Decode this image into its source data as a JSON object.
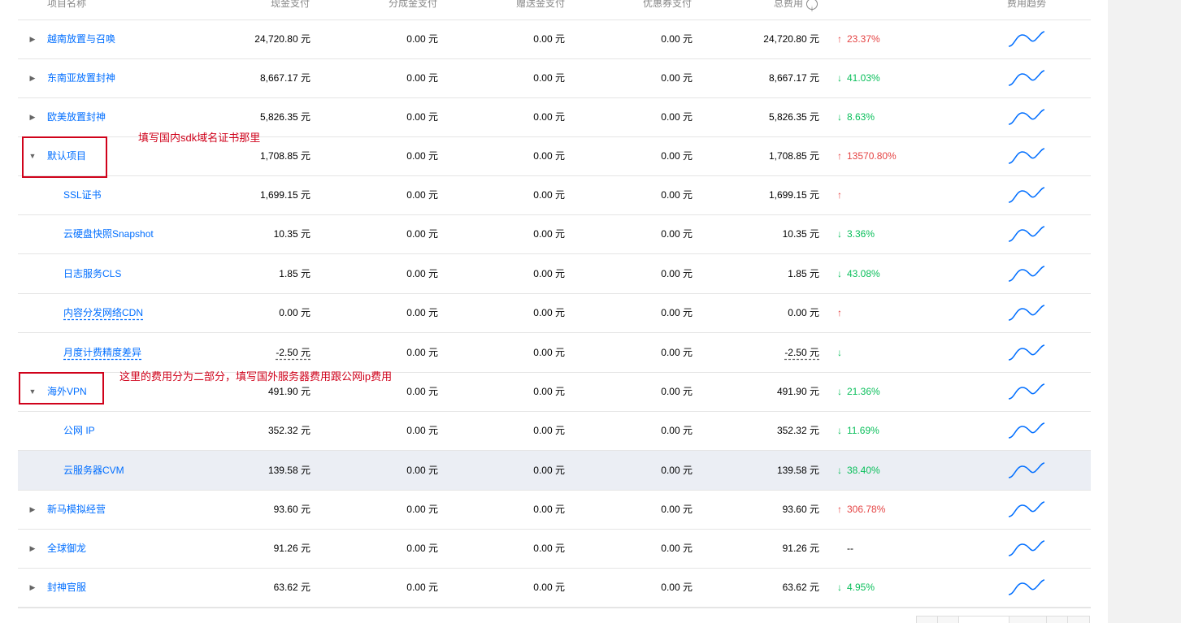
{
  "header": {
    "project_name": "项目名称",
    "cash_pay": "现金支付",
    "share_pay": "分成金支付",
    "gift_pay": "赠送金支付",
    "voucher_pay": "优惠券支付",
    "total_cost": "总费用",
    "cost_trend": "费用趋势"
  },
  "rows": [
    {
      "name": "越南放置与召唤",
      "cash": "24,720.80 元",
      "share": "0.00 元",
      "gift": "0.00 元",
      "voucher": "0.00 元",
      "total": "24,720.80 元",
      "trend_dir": "up",
      "trend_arrow": "↑",
      "trend": "23.37%"
    },
    {
      "name": "东南亚放置封神",
      "cash": "8,667.17 元",
      "share": "0.00 元",
      "gift": "0.00 元",
      "voucher": "0.00 元",
      "total": "8,667.17 元",
      "trend_dir": "down",
      "trend_arrow": "↓",
      "trend": "41.03%"
    },
    {
      "name": "欧美放置封神",
      "cash": "5,826.35 元",
      "share": "0.00 元",
      "gift": "0.00 元",
      "voucher": "0.00 元",
      "total": "5,826.35 元",
      "trend_dir": "down",
      "trend_arrow": "↓",
      "trend": "8.63%"
    },
    {
      "name": "默认项目",
      "cash": "1,708.85 元",
      "share": "0.00 元",
      "gift": "0.00 元",
      "voucher": "0.00 元",
      "total": "1,708.85 元",
      "trend_dir": "up",
      "trend_arrow": "↑",
      "trend": "13570.80%"
    },
    {
      "name": "SSL证书",
      "cash": "1,699.15 元",
      "share": "0.00 元",
      "gift": "0.00 元",
      "voucher": "0.00 元",
      "total": "1,699.15 元",
      "trend_dir": "up",
      "trend_arrow": "↑",
      "trend": ""
    },
    {
      "name": "云硬盘快照Snapshot",
      "cash": "10.35 元",
      "share": "0.00 元",
      "gift": "0.00 元",
      "voucher": "0.00 元",
      "total": "10.35 元",
      "trend_dir": "down",
      "trend_arrow": "↓",
      "trend": "3.36%"
    },
    {
      "name": "日志服务CLS",
      "cash": "1.85 元",
      "share": "0.00 元",
      "gift": "0.00 元",
      "voucher": "0.00 元",
      "total": "1.85 元",
      "trend_dir": "down",
      "trend_arrow": "↓",
      "trend": "43.08%"
    },
    {
      "name": "内容分发网络CDN",
      "cash": "0.00 元",
      "share": "0.00 元",
      "gift": "0.00 元",
      "voucher": "0.00 元",
      "total": "0.00 元",
      "trend_dir": "up",
      "trend_arrow": "↑",
      "trend": ""
    },
    {
      "name": "月度计费精度差异",
      "cash": "-2.50 元",
      "share": "0.00 元",
      "gift": "0.00 元",
      "voucher": "0.00 元",
      "total": "-2.50 元",
      "trend_dir": "down",
      "trend_arrow": "↓",
      "trend": ""
    },
    {
      "name": "海外VPN",
      "cash": "491.90 元",
      "share": "0.00 元",
      "gift": "0.00 元",
      "voucher": "0.00 元",
      "total": "491.90 元",
      "trend_dir": "down",
      "trend_arrow": "↓",
      "trend": "21.36%"
    },
    {
      "name": "公网 IP",
      "cash": "352.32 元",
      "share": "0.00 元",
      "gift": "0.00 元",
      "voucher": "0.00 元",
      "total": "352.32 元",
      "trend_dir": "down",
      "trend_arrow": "↓",
      "trend": "11.69%"
    },
    {
      "name": "云服务器CVM",
      "cash": "139.58 元",
      "share": "0.00 元",
      "gift": "0.00 元",
      "voucher": "0.00 元",
      "total": "139.58 元",
      "trend_dir": "down",
      "trend_arrow": "↓",
      "trend": "38.40%"
    },
    {
      "name": "新马模拟经营",
      "cash": "93.60 元",
      "share": "0.00 元",
      "gift": "0.00 元",
      "voucher": "0.00 元",
      "total": "93.60 元",
      "trend_dir": "up",
      "trend_arrow": "↑",
      "trend": "306.78%"
    },
    {
      "name": "全球御龙",
      "cash": "91.26 元",
      "share": "0.00 元",
      "gift": "0.00 元",
      "voucher": "0.00 元",
      "total": "91.26 元",
      "trend_dir": "flat",
      "trend_arrow": "",
      "trend": "--"
    },
    {
      "name": "封神官服",
      "cash": "63.62 元",
      "share": "0.00 元",
      "gift": "0.00 元",
      "voucher": "0.00 元",
      "total": "63.62 元",
      "trend_dir": "down",
      "trend_arrow": "↓",
      "trend": "4.95%"
    }
  ],
  "annotations": {
    "default_project_note": "填写国内sdk域名证书那里",
    "vpn_note": "这里的费用分为二部分，填写国外服务器费用跟公网ip费用"
  },
  "colors": {
    "link": "#006eff",
    "up": "#e54545",
    "down": "#0abf5b",
    "annotation": "#d0021b",
    "highlight_row": "#ebeef4"
  }
}
